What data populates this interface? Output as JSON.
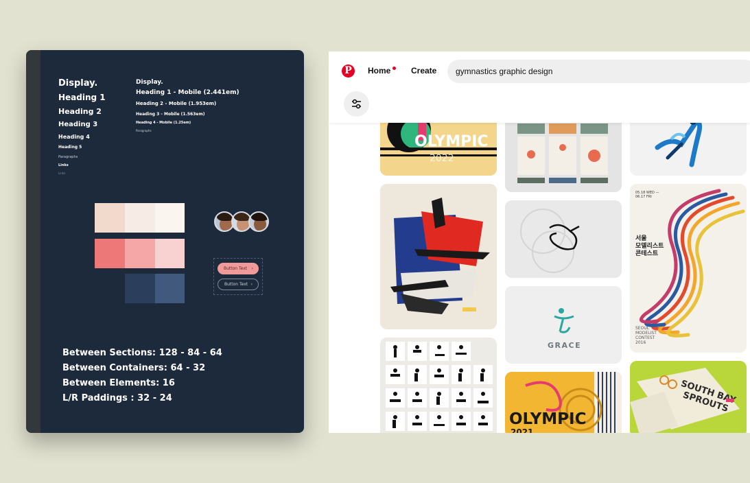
{
  "style_guide": {
    "headings_left": [
      "Display.",
      "Heading 1",
      "Heading 2",
      "Heading 3",
      "Heading 4",
      "Heading 5",
      "Paragraphs",
      "Links",
      "Links"
    ],
    "headings_right": [
      "Display.",
      "Heading 1 - Mobile (2.441em)",
      "Heading 2 - Mobile (1.953em)",
      "Heading 3 - Mobile (1.563em)",
      "Heading 4 - Mobile (1.25em)",
      "Paragraphs"
    ],
    "colors": {
      "row1": [
        "#f1d9cc",
        "#f6ece5",
        "#faf5ef"
      ],
      "row2": [
        "#ec7877",
        "#f4a7a6",
        "#f8d1d1"
      ],
      "row3": [
        "#2b3e5b",
        "#40597d"
      ]
    },
    "avatars": [
      "avatar-1",
      "avatar-2",
      "avatar-3"
    ],
    "buttons": {
      "primary_label": "Button Text",
      "secondary_label": "Button Text",
      "arrow": "›"
    },
    "spacing": [
      "Between Sections: 128 - 84 - 64",
      "Between Containers: 64 - 32",
      "Between Elements: 16",
      "L/R Paddings : 32 - 24"
    ]
  },
  "pinterest": {
    "logo_letter": "P",
    "nav": {
      "home": "Home",
      "create": "Create"
    },
    "search": {
      "value": "gymnastics graphic design"
    },
    "brand_color": "#e60023",
    "pins": {
      "olympic_top_text": "OLYMPIC",
      "olympic_top_year": "2022",
      "korean_title": "서울\n모델리스트\n콘테스트",
      "korean_date": "05.18 WED —\n06.17 FRI",
      "korean_footer": "SEOUL\nMODELIST\nCONTEST\n2016",
      "grace_text": "GRACE",
      "olympic_bottom_text": "OLYMPIC",
      "olympic_bottom_year": "2021",
      "south_bay_text": "SOUTH BAY\nSPROUTS"
    }
  }
}
